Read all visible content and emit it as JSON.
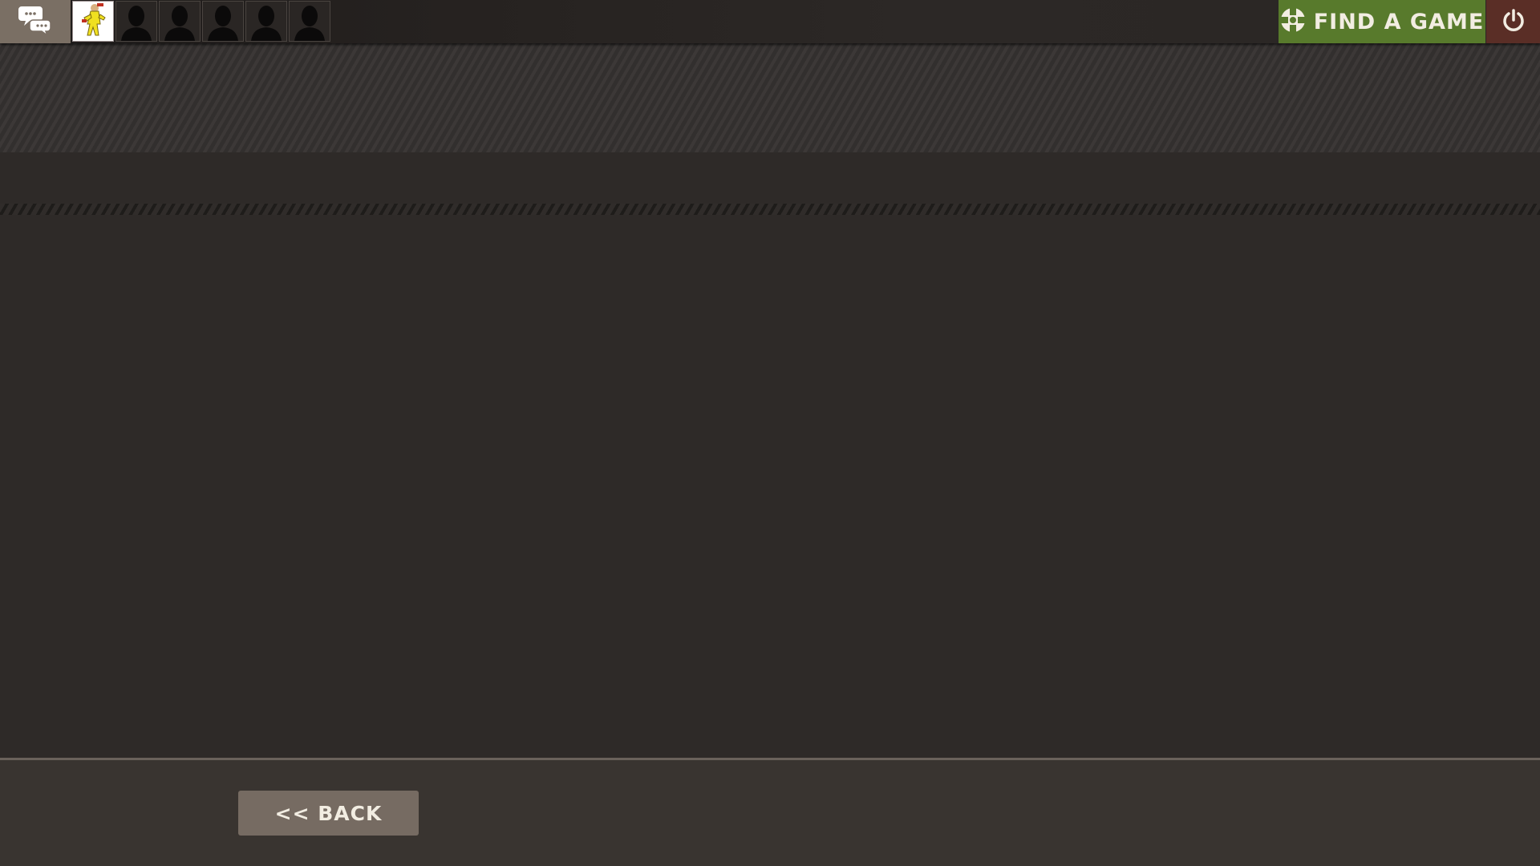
{
  "topbar": {
    "chat_icon": "chat-bubbles-icon",
    "party": {
      "slots": [
        {
          "type": "player",
          "icon": "player-avatar"
        },
        {
          "type": "empty",
          "icon": "silhouette-icon"
        },
        {
          "type": "empty",
          "icon": "silhouette-icon"
        },
        {
          "type": "empty",
          "icon": "silhouette-icon"
        },
        {
          "type": "empty",
          "icon": "silhouette-icon"
        },
        {
          "type": "empty",
          "icon": "silhouette-icon"
        }
      ]
    },
    "find_game": {
      "label": "FIND A GAME",
      "icon": "tf2-logo-icon",
      "color": "#587a2c"
    },
    "quit": {
      "icon": "power-icon",
      "color": "#5a2e26"
    }
  },
  "footer": {
    "back_label": "<< BACK"
  },
  "colors": {
    "background": "#2e2a28",
    "button": "#766b62",
    "text": "#f2ede2"
  }
}
